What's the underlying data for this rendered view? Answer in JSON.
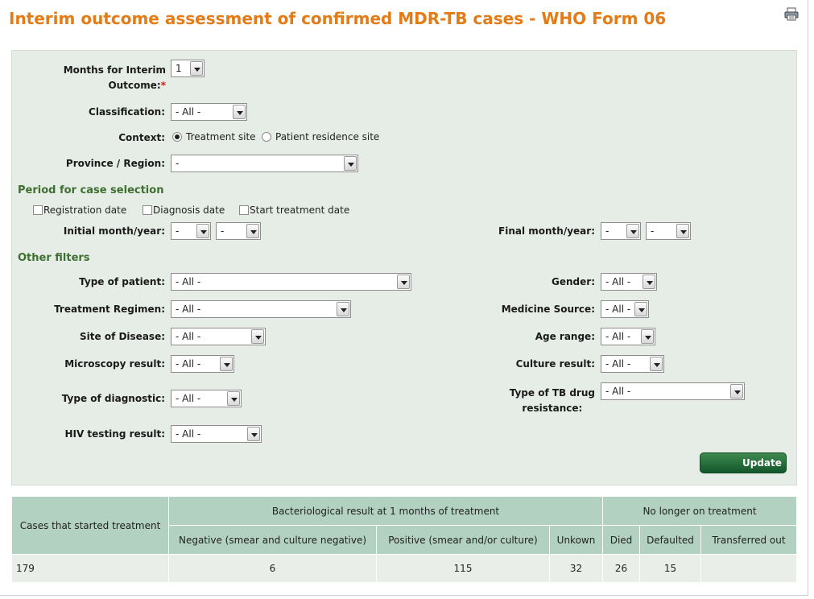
{
  "page": {
    "title": "Interim outcome assessment of confirmed MDR-TB cases - WHO Form 06",
    "print_icon": "printer-icon"
  },
  "filters": {
    "months_label_line1": "Months for Interim",
    "months_label_line2": "Outcome:",
    "required_mark": "*",
    "months_value": "1",
    "classification_label": "Classification:",
    "classification_value": "- All -",
    "context_label": "Context:",
    "context_options": [
      "Treatment site",
      "Patient residence site"
    ],
    "context_selected": "Treatment site",
    "province_label": "Province / Region:",
    "province_value": "-"
  },
  "period": {
    "heading": "Period for case selection",
    "checkboxes": [
      "Registration date",
      "Diagnosis date",
      "Start treatment date"
    ],
    "initial_label": "Initial month/year:",
    "initial_month": "-",
    "initial_year": "-",
    "final_label": "Final month/year:",
    "final_month": "-",
    "final_year": "-"
  },
  "other": {
    "heading": "Other filters",
    "patient_type_label": "Type of patient:",
    "patient_type_value": "- All -",
    "regimen_label": "Treatment Regimen:",
    "regimen_value": "- All -",
    "site_label": "Site of Disease:",
    "site_value": "- All -",
    "microscopy_label": "Microscopy result:",
    "microscopy_value": "- All -",
    "diagnostic_label": "Type of diagnostic:",
    "diagnostic_value": "- All -",
    "hiv_label": "HIV testing result:",
    "hiv_value": "- All -",
    "gender_label": "Gender:",
    "gender_value": "- All -",
    "medicine_label": "Medicine Source:",
    "medicine_value": "- All -",
    "age_label": "Age range:",
    "age_value": "- All -",
    "culture_label": "Culture result:",
    "culture_value": "- All -",
    "resistance_label_line1": "Type of TB drug",
    "resistance_label_line2": "resistance:",
    "resistance_value": "- All -"
  },
  "update_button": "Update",
  "results": {
    "col_cases": "Cases that started treatment",
    "group_bacteriological": "Bacteriological result at 1 months of treatment",
    "group_no_longer": "No longer on treatment",
    "col_negative": "Negative (smear and culture negative)",
    "col_positive": "Positive (smear and/or culture)",
    "col_unknown": "Unkown",
    "col_died": "Died",
    "col_defaulted": "Defaulted",
    "col_transferred": "Transferred out",
    "row": {
      "cases": "179",
      "negative": "6",
      "positive": "115",
      "unknown": "32",
      "died": "26",
      "defaulted": "15",
      "transferred": ""
    }
  }
}
